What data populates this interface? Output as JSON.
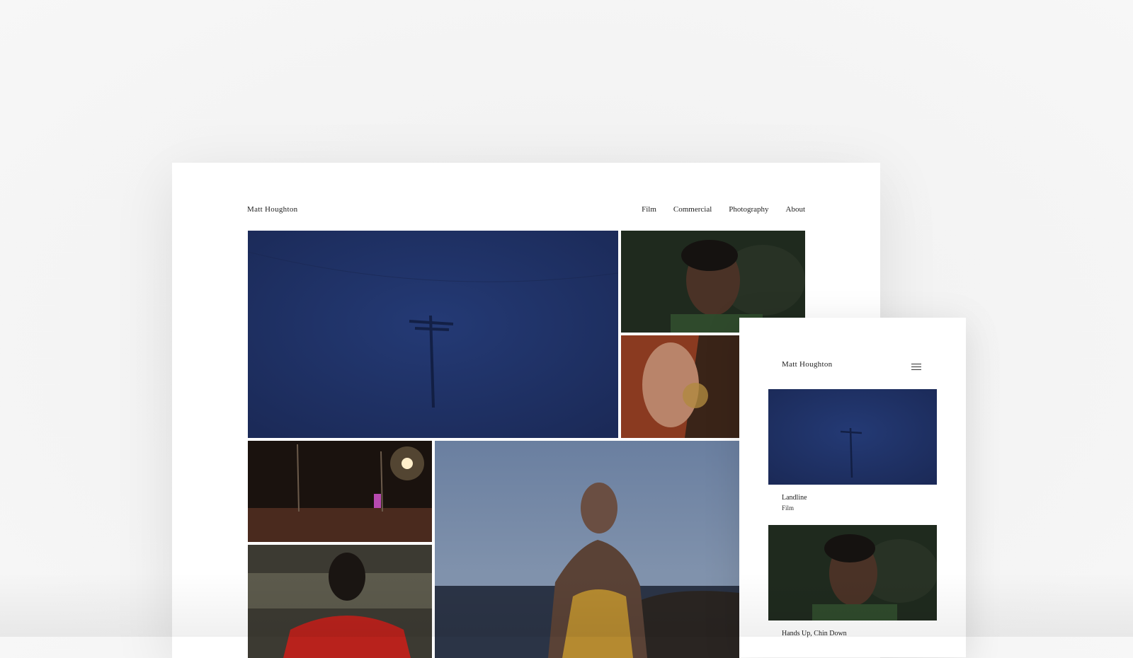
{
  "desktop": {
    "site_title": "Matt Houghton",
    "nav": [
      "Film",
      "Commercial",
      "Photography",
      "About"
    ]
  },
  "mobile": {
    "site_title": "Matt Houghton",
    "menu_icon": "hamburger-menu-icon",
    "projects": [
      {
        "title": "Landline",
        "category": "Film"
      },
      {
        "title": "Hands Up, Chin Down",
        "category": ""
      }
    ]
  },
  "colors": {
    "night_blue": "#1f2f5f",
    "text": "#222222",
    "background": "#f5f5f5"
  }
}
